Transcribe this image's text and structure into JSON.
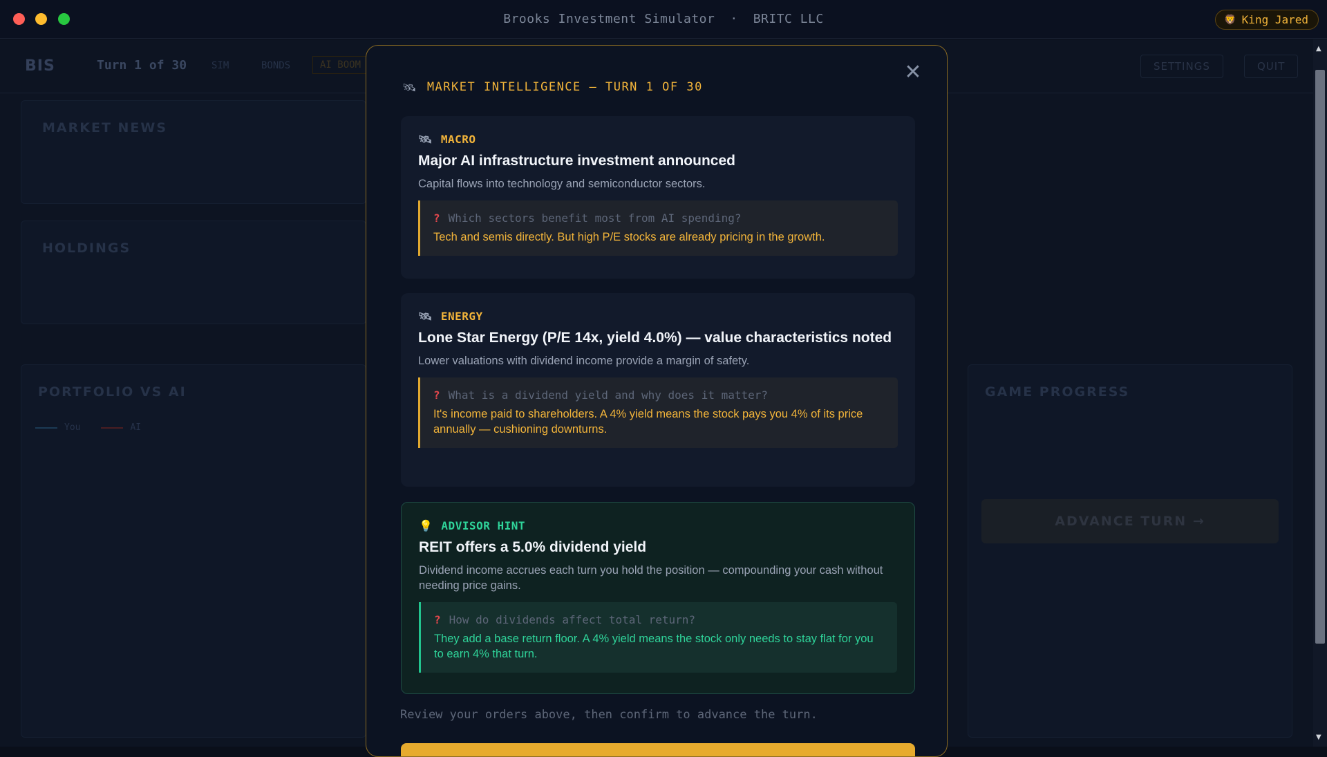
{
  "window": {
    "title": "Brooks Investment Simulator",
    "separator": "·",
    "company": "BRITC LLC",
    "user": "King Jared",
    "user_icon": "lion-icon"
  },
  "app": {
    "logo": "BIS",
    "turn": "Turn 1 of 30",
    "tabs": [
      "SIM",
      "BONDS",
      "AI BOOM"
    ],
    "settings_label": "SETTINGS",
    "quit_label": "QUIT",
    "market_news_title": "MARKET NEWS",
    "holdings_title": "HOLDINGS",
    "portfolio_title": "PORTFOLIO VS AI",
    "legend_you": "You",
    "legend_ai": "AI",
    "game_progress_title": "GAME PROGRESS",
    "advance_label": "ADVANCE TURN →"
  },
  "modal": {
    "header": "MARKET INTELLIGENCE — TURN 1 OF 30",
    "close_icon": "close-icon",
    "cards": [
      {
        "tag": "MACRO",
        "title": "Major AI infrastructure investment announced",
        "description": "Capital flows into technology and semiconductor sectors.",
        "question": "Which sectors benefit most from AI spending?",
        "answer": "Tech and semis directly. But high P/E stocks are already pricing in the growth."
      },
      {
        "tag": "ENERGY",
        "title": "Lone Star Energy (P/E 14x, yield 4.0%) — value characteristics noted",
        "description": "Lower valuations with dividend income provide a margin of safety.",
        "question": "What is a dividend yield and why does it matter?",
        "answer": "It's income paid to shareholders. A 4% yield means the stock pays you 4% of its price annually — cushioning downturns."
      }
    ],
    "hint": {
      "tag": "ADVISOR HINT",
      "title": "REIT offers a 5.0% dividend yield",
      "description": "Dividend income accrues each turn you hold the position — compounding your cash without needing price gains.",
      "question": "How do dividends affect total return?",
      "answer": "They add a base return floor. A 4% yield means the stock only needs to stay flat for you to earn 4% that turn."
    },
    "footer_note": "Review your orders above, then confirm to advance the turn."
  },
  "colors": {
    "accent": "#f2b43a",
    "hint": "#2fd49a",
    "background": "#0c1322"
  }
}
